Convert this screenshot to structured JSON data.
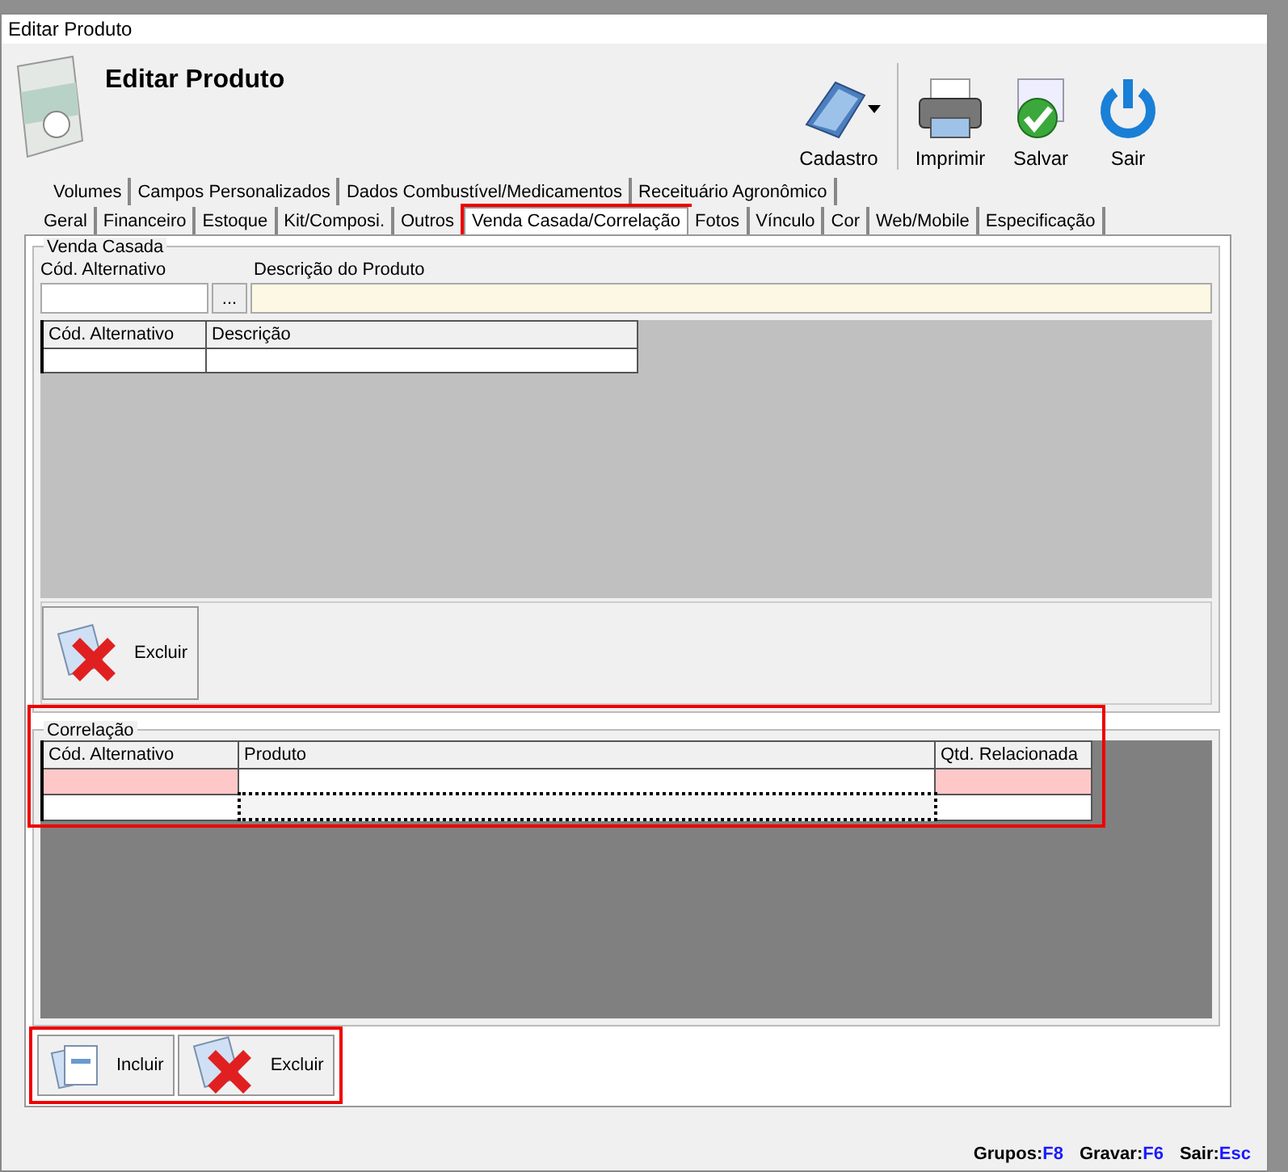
{
  "window": {
    "title": "Editar Produto"
  },
  "header": {
    "title": "Editar Produto"
  },
  "toolbar": [
    {
      "label": "Cadastro",
      "kind": "folder",
      "dropdown": true
    },
    {
      "label": "Imprimir",
      "kind": "printer",
      "dropdown": false
    },
    {
      "label": "Salvar",
      "kind": "save",
      "dropdown": false
    },
    {
      "label": "Sair",
      "kind": "power",
      "dropdown": false
    }
  ],
  "tab_rows": [
    [
      {
        "label": "Volumes",
        "selected": false,
        "highlighted": false
      },
      {
        "label": "Campos Personalizados",
        "selected": false,
        "highlighted": false
      },
      {
        "label": "Dados Combustível/Medicamentos",
        "selected": false,
        "highlighted": false
      },
      {
        "label": "Receituário Agronômico",
        "selected": false,
        "highlighted": false
      }
    ],
    [
      {
        "label": "Geral",
        "selected": false,
        "highlighted": false
      },
      {
        "label": "Financeiro",
        "selected": false,
        "highlighted": false
      },
      {
        "label": "Estoque",
        "selected": false,
        "highlighted": false
      },
      {
        "label": "Kit/Composi.",
        "selected": false,
        "highlighted": false
      },
      {
        "label": "Outros",
        "selected": false,
        "highlighted": false
      },
      {
        "label": "Venda Casada/Correlação",
        "selected": true,
        "highlighted": true
      },
      {
        "label": "Fotos",
        "selected": false,
        "highlighted": false
      },
      {
        "label": "Vínculo",
        "selected": false,
        "highlighted": false
      },
      {
        "label": "Cor",
        "selected": false,
        "highlighted": false
      },
      {
        "label": "Web/Mobile",
        "selected": false,
        "highlighted": false
      },
      {
        "label": "Especificação",
        "selected": false,
        "highlighted": false
      }
    ]
  ],
  "venda_casada": {
    "title": "Venda Casada",
    "code_label": "Cód. Alternativo",
    "lookup_button": "...",
    "description_label": "Descrição do Produto",
    "table": {
      "columns": [
        "Cód. Alternativo",
        "Descrição"
      ],
      "rows": [
        [
          {
            "required": false,
            "focused": false
          },
          {
            "required": false,
            "focused": false
          }
        ]
      ]
    },
    "buttons": [
      {
        "label": "Excluir",
        "kind": "delete"
      }
    ]
  },
  "correlacao": {
    "title": "Correlação",
    "highlighted": true,
    "table": {
      "columns": [
        "Cód. Alternativo",
        "Produto",
        "Qtd. Relacionada"
      ],
      "rows": [
        [
          {
            "required": true,
            "focused": false
          },
          {
            "required": false,
            "focused": false
          },
          {
            "required": true,
            "focused": false
          }
        ],
        [
          {
            "required": false,
            "focused": false
          },
          {
            "required": false,
            "focused": true
          },
          {
            "required": false,
            "focused": false
          }
        ]
      ]
    },
    "buttons_highlighted": true,
    "buttons": [
      {
        "label": "Incluir",
        "kind": "add"
      },
      {
        "label": "Excluir",
        "kind": "delete"
      }
    ]
  },
  "status_bar": [
    {
      "label": "Grupos:",
      "key": "F8"
    },
    {
      "label": "Gravar:",
      "key": "F6"
    },
    {
      "label": "Sair:",
      "key": "Esc"
    }
  ]
}
